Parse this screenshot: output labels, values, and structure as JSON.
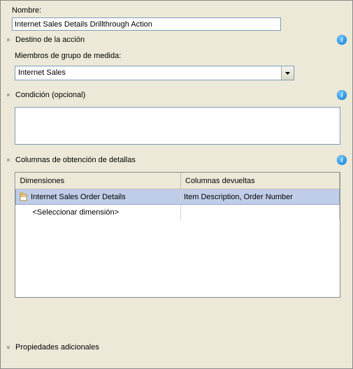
{
  "name_section": {
    "label": "Nombre:",
    "value": "Internet Sales Details Drillthrough Action"
  },
  "target_section": {
    "title": "Destino de la acción",
    "measure_label": "Miembros de grupo de medida:",
    "selected": "Internet Sales"
  },
  "condition_section": {
    "title": "Condición (opcional)",
    "value": ""
  },
  "drill_section": {
    "title": "Columnas de obtención de detallas",
    "col_dimensions": "Dimensiones",
    "col_returned": "Columnas devueltas",
    "rows": [
      {
        "dimension": "Internet Sales Order Details",
        "returned": "Item Description, Order Number"
      }
    ],
    "placeholder": "<Seleccionar dimensión>"
  },
  "additional_section": {
    "title": "Propiedades adicionales"
  }
}
